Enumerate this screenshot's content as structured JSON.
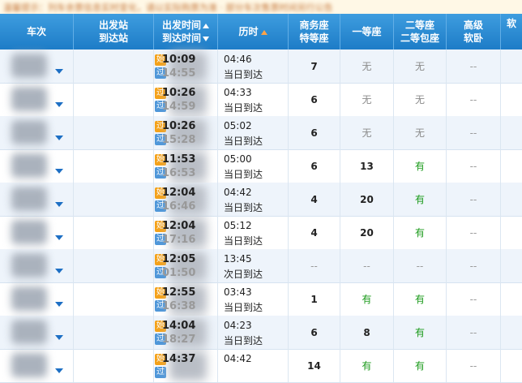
{
  "notice": {
    "text": "温馨提示：列车余票信息实时变化，请以实际购票为准 · 部分车次售票时间另行公告"
  },
  "header": {
    "train_no": "车次",
    "from_station": "出发站",
    "to_station": "到达站",
    "depart_time": "出发时间",
    "arrive_time": "到达时间",
    "duration": "历时",
    "business_1": "商务座",
    "business_2": "特等座",
    "first_class": "一等座",
    "second_1": "二等座",
    "second_2": "二等包座",
    "premium_1": "高级",
    "premium_2": "软卧",
    "next_col": "软"
  },
  "badges": {
    "start": "始",
    "pass": "过"
  },
  "rows": [
    {
      "dep": "10:09",
      "arr": "14:55",
      "dur": "04:46",
      "day": "当日到达",
      "start_badge": "始",
      "business": "7",
      "business_kind": "num",
      "first": "无",
      "first_kind": "none",
      "second": "无",
      "second_kind": "none",
      "premium": "--"
    },
    {
      "dep": "10:26",
      "arr": "14:59",
      "dur": "04:33",
      "day": "当日到达",
      "start_badge": "过",
      "business": "6",
      "business_kind": "num",
      "first": "无",
      "first_kind": "none",
      "second": "无",
      "second_kind": "none",
      "premium": "--"
    },
    {
      "dep": "10:26",
      "arr": "15:28",
      "dur": "05:02",
      "day": "当日到达",
      "start_badge": "过",
      "business": "6",
      "business_kind": "num",
      "first": "无",
      "first_kind": "none",
      "second": "无",
      "second_kind": "none",
      "premium": "--"
    },
    {
      "dep": "11:53",
      "arr": "16:53",
      "dur": "05:00",
      "day": "当日到达",
      "start_badge": "始",
      "business": "6",
      "business_kind": "num",
      "first": "13",
      "first_kind": "num",
      "second": "有",
      "second_kind": "yes",
      "premium": "--"
    },
    {
      "dep": "12:04",
      "arr": "16:46",
      "dur": "04:42",
      "day": "当日到达",
      "start_badge": "始",
      "business": "4",
      "business_kind": "num",
      "first": "20",
      "first_kind": "num",
      "second": "有",
      "second_kind": "yes",
      "premium": "--"
    },
    {
      "dep": "12:04",
      "arr": "17:16",
      "dur": "05:12",
      "day": "当日到达",
      "start_badge": "始",
      "business": "4",
      "business_kind": "num",
      "first": "20",
      "first_kind": "num",
      "second": "有",
      "second_kind": "yes",
      "premium": "--"
    },
    {
      "dep": "12:05",
      "arr": "01:50",
      "dur": "13:45",
      "day": "次日到达",
      "start_badge": "始",
      "business": "--",
      "business_kind": "dash",
      "first": "--",
      "first_kind": "dash",
      "second": "--",
      "second_kind": "dash",
      "premium": "--"
    },
    {
      "dep": "12:55",
      "arr": "16:38",
      "dur": "03:43",
      "day": "当日到达",
      "start_badge": "始",
      "business": "1",
      "business_kind": "num",
      "first": "有",
      "first_kind": "yes",
      "second": "有",
      "second_kind": "yes",
      "premium": "--"
    },
    {
      "dep": "14:04",
      "arr": "18:27",
      "dur": "04:23",
      "day": "当日到达",
      "start_badge": "始",
      "business": "6",
      "business_kind": "num",
      "first": "8",
      "first_kind": "num",
      "second": "有",
      "second_kind": "yes",
      "premium": "--"
    },
    {
      "dep": "14:37",
      "arr": "",
      "dur": "04:42",
      "day": "",
      "start_badge": "始",
      "business": "14",
      "business_kind": "num",
      "first": "有",
      "first_kind": "yes",
      "second": "有",
      "second_kind": "yes",
      "premium": "--"
    }
  ],
  "colors": {
    "header_top": "#3e9ddf",
    "header_bottom": "#1d7cc7",
    "row_alt": "#eef4fb",
    "yes_green": "#1a9a1a",
    "start_badge": "#f4a21b",
    "pass_badge": "#4f97d9"
  }
}
